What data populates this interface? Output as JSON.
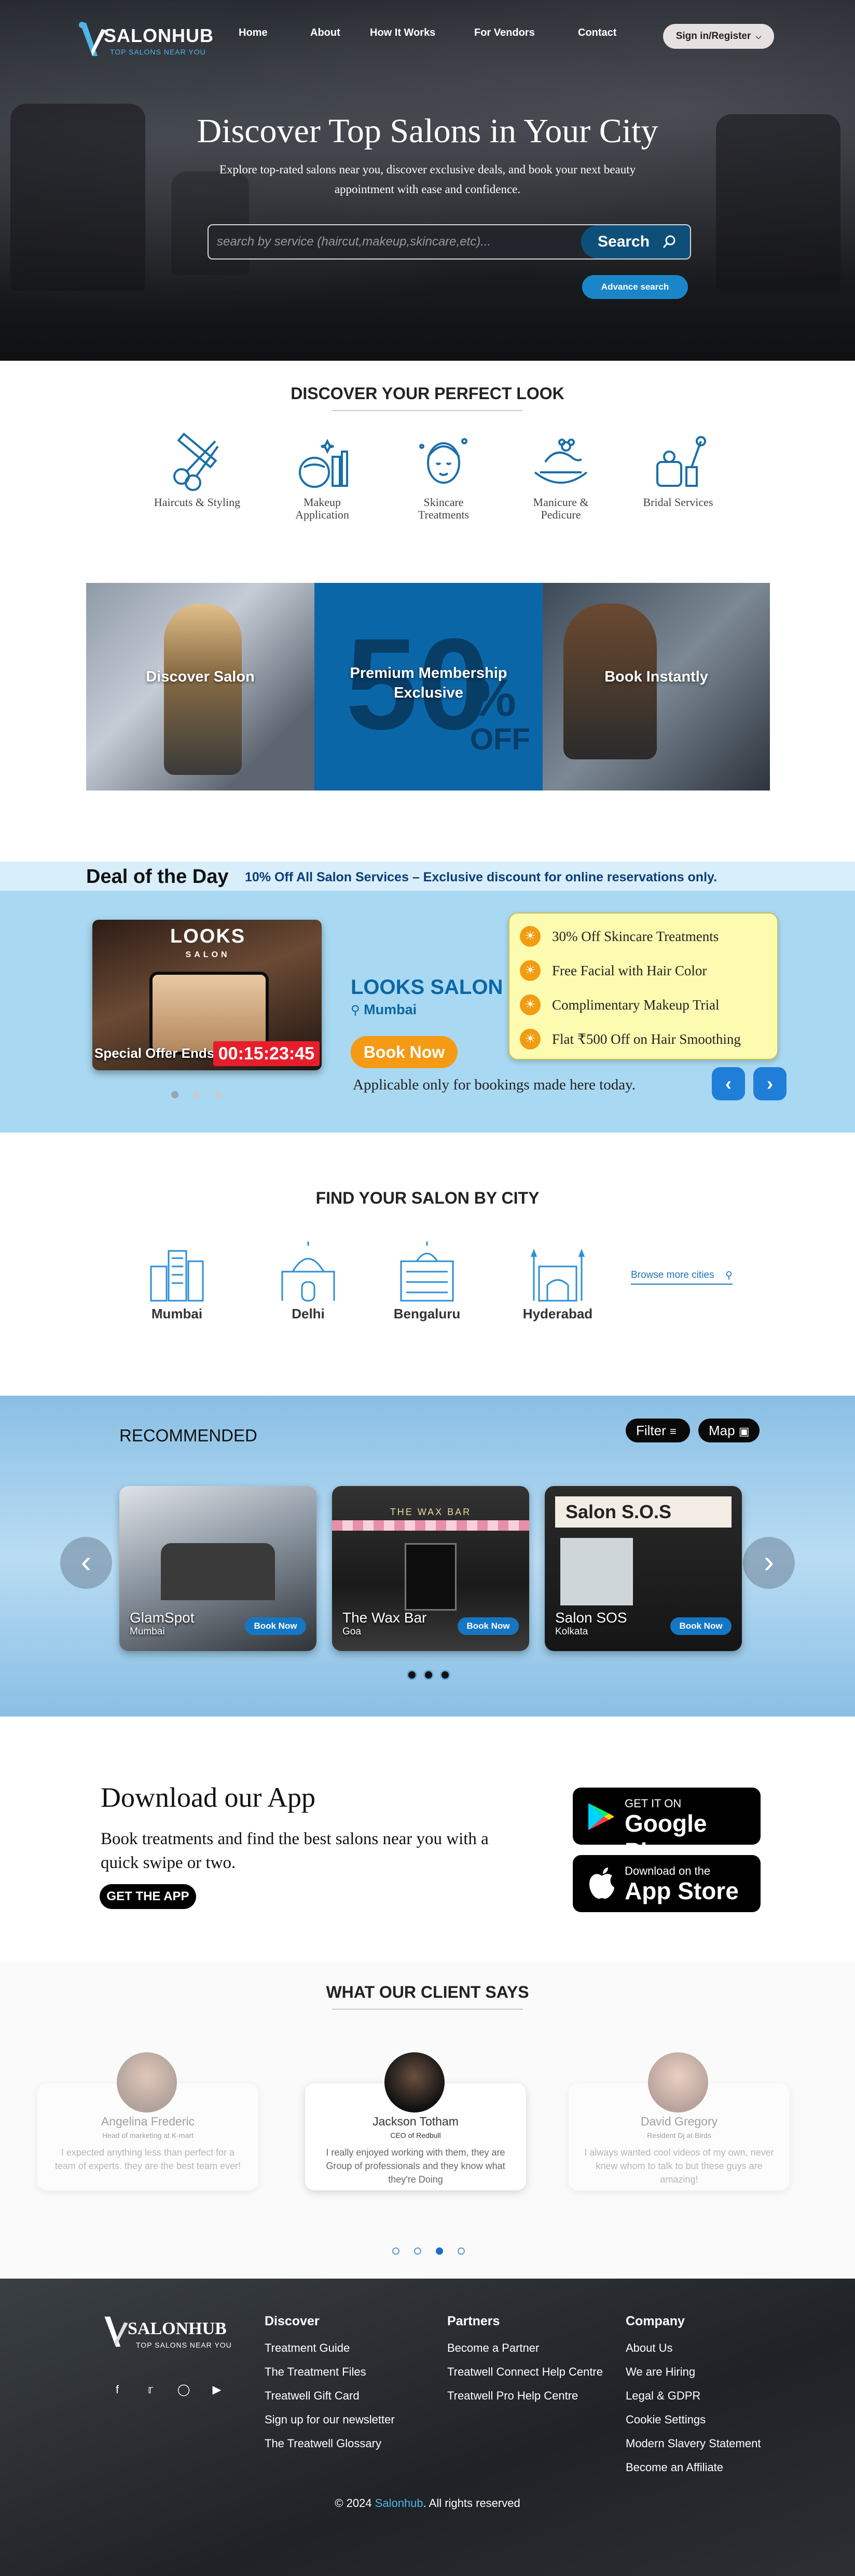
{
  "header": {
    "logo_name": "SALONHUB",
    "logo_tagline": "TOP SALONS NEAR YOU",
    "nav": [
      "Home",
      "About",
      "How It Works",
      "For Vendors",
      "Contact"
    ],
    "signin": "Sign in/Register"
  },
  "hero": {
    "title": "Discover Top Salons in Your City",
    "subtitle": "Explore top-rated salons near you, discover exclusive deals, and book your next beauty appointment with ease and confidence.",
    "search_placeholder": "search by service (haircut,makeup,skincare,etc)...",
    "search_button": "Search",
    "advanced_search": "Advance search"
  },
  "looks": {
    "title": "DISCOVER YOUR PERFECT LOOK",
    "items": [
      {
        "label": "Haircuts & Styling",
        "icon": "scissors-comb-icon"
      },
      {
        "label": "Makeup Application",
        "icon": "makeup-icon"
      },
      {
        "label": "Skincare Treatments",
        "icon": "face-spa-icon"
      },
      {
        "label": "Manicure & Pedicure",
        "icon": "manicure-icon"
      },
      {
        "label": "Bridal Services",
        "icon": "bridal-kit-icon"
      }
    ]
  },
  "promo": {
    "discover": "Discover Salon",
    "membership_line1": "Premium Membership",
    "membership_line2": "Exclusive",
    "fifty": "50",
    "percent": "%",
    "off": "OFF",
    "book": "Book Instantly"
  },
  "deal": {
    "title": "Deal of the Day",
    "subtitle": "10% Off All Salon Services – Exclusive discount for online reservations only.",
    "sign_main": "LOOKS",
    "sign_sub": "SALON",
    "offer_label": "Special Offer Ends In:",
    "timer": "00:15:23:45",
    "salon_name": "LOOKS SALON",
    "salon_city": "Mumbai",
    "book_button": "Book Now",
    "note": "Applicable only for bookings made here today.",
    "offers": [
      "30% Off Skincare Treatments",
      "Free Facial with Hair Color",
      "Complimentary Makeup Trial",
      "Flat ₹500 Off on Hair Smoothing"
    ]
  },
  "cities": {
    "title": "FIND YOUR SALON BY CITY",
    "items": [
      "Mumbai",
      "Delhi",
      "Bengaluru",
      "Hyderabad"
    ],
    "browse": "Browse more cities"
  },
  "recommended": {
    "title": "RECOMMENDED",
    "filter": "Filter",
    "map": "Map",
    "cards": [
      {
        "name": "GlamSpot",
        "city": "Mumbai",
        "button": "Book Now"
      },
      {
        "name": "The Wax Bar",
        "city": "Goa",
        "button": "Book Now",
        "sign": "THE WAX BAR"
      },
      {
        "name": "Salon SOS",
        "city": "Kolkata",
        "button": "Book Now",
        "sign": "Salon S.O.S"
      }
    ]
  },
  "app": {
    "title": "Download our App",
    "text": "Book treatments and find the best salons near you with a quick swipe or two.",
    "button": "GET THE APP",
    "google_small": "GET IT ON",
    "google_big": "Google Play",
    "apple_small": "Download on the",
    "apple_big": "App Store"
  },
  "testimonials": {
    "title": "WHAT OUR CLIENT SAYS",
    "items": [
      {
        "name": "Angelina Frederic",
        "role": "Head of marketing at K-mart",
        "quote": "I expected anything less than perfect for a team of experts. they are the best team ever!"
      },
      {
        "name": "Jackson Totham",
        "role": "CEO of Redbull",
        "quote": "I really enjoyed working with them, they are Group of professionals and they know what they're Doing"
      },
      {
        "name": "David Gregory",
        "role": "Resident Dj at Birds",
        "quote": "I always wanted cool videos of my own, never knew whom to talk to but these guys are amazing!"
      }
    ]
  },
  "footer": {
    "logo_name": "SALONHUB",
    "logo_tagline": "TOP SALONS NEAR YOU",
    "social": [
      "facebook-icon",
      "twitter-icon",
      "instagram-icon",
      "youtube-icon"
    ],
    "discover": {
      "title": "Discover",
      "links": [
        "Treatment Guide",
        "The Treatment Files",
        "Treatwell Gift Card",
        "Sign up for our newsletter",
        "The Treatwell Glossary"
      ]
    },
    "partners": {
      "title": "Partners",
      "links": [
        "Become a Partner",
        "Treatwell Connect Help Centre",
        "Treatwell Pro Help Centre"
      ]
    },
    "company": {
      "title": "Company",
      "links": [
        "About Us",
        "We are Hiring",
        "Legal & GDPR",
        "Cookie Settings",
        "Modern Slavery Statement",
        "Become an Affiliate"
      ]
    },
    "copyright_prefix": "© 2024 ",
    "copyright_brand": "Salonhub",
    "copyright_suffix": ". All rights reserved"
  },
  "colors": {
    "accent": "#1a86c8",
    "deal_bg": "#a9d8f2",
    "offer_orange": "#f49a14",
    "timer_red": "#e61e2b",
    "brand_blue": "#0b67a5"
  }
}
